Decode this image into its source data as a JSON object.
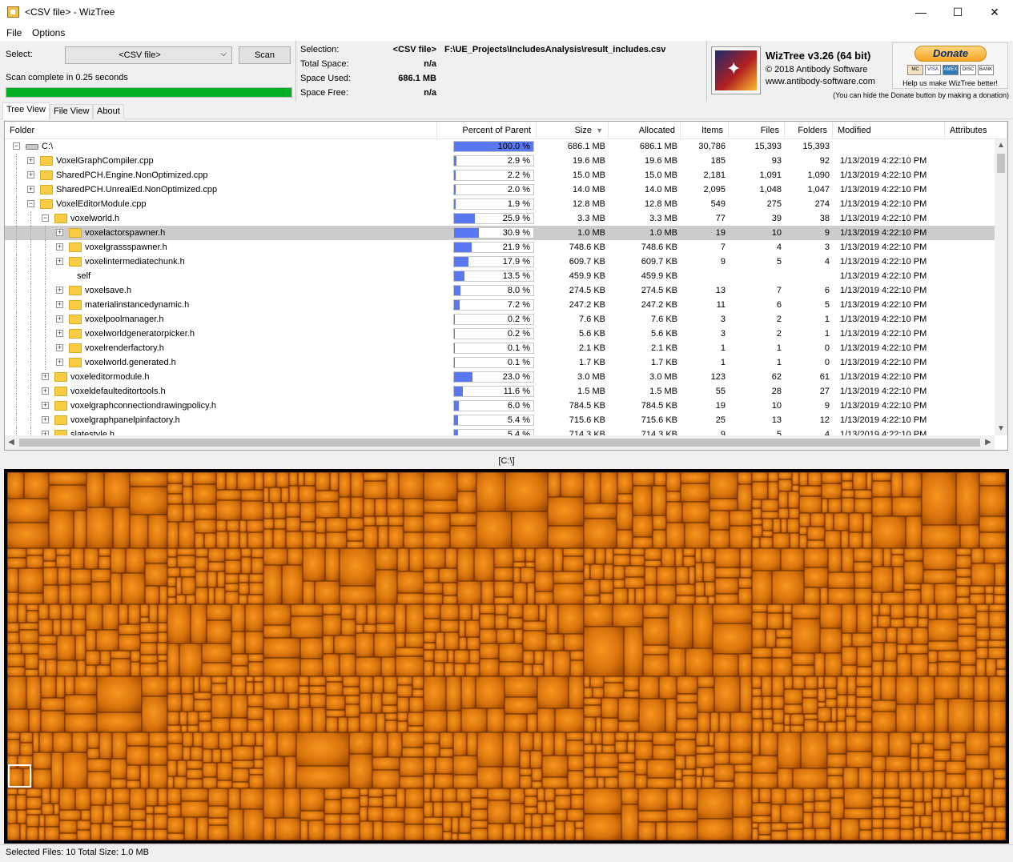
{
  "window": {
    "title": "<CSV file> - WizTree",
    "minimize": "—",
    "maximize": "☐",
    "close": "✕"
  },
  "menu": {
    "file": "File",
    "options": "Options"
  },
  "toolbar": {
    "select_label": "Select:",
    "source_value": "<CSV file>",
    "scan_label": "Scan",
    "scan_status": "Scan complete in 0.25 seconds",
    "progress_fraction": 1.0
  },
  "info": {
    "selection_label": "Selection:",
    "selection_value": "<CSV file>",
    "selection_path": "F:\\UE_Projects\\IncludesAnalysis\\result_includes.csv",
    "total_label": "Total Space:",
    "total_value": "n/a",
    "used_label": "Space Used:",
    "used_value": "686.1 MB",
    "free_label": "Space Free:",
    "free_value": "n/a"
  },
  "about": {
    "product": "WizTree v3.26 (64 bit)",
    "copyright": "© 2018 Antibody Software",
    "website": "www.antibody-software.com"
  },
  "donate": {
    "button": "Donate",
    "cards": [
      "MC",
      "VISA",
      "AMEX",
      "DISC",
      "BANK"
    ],
    "help": "Help us make WizTree better!",
    "note": "(You can hide the Donate button by making a donation)"
  },
  "tabs": [
    {
      "label": "Tree View"
    },
    {
      "label": "File View"
    },
    {
      "label": "About"
    }
  ],
  "columns": {
    "folder": "Folder",
    "percent": "Percent of Parent",
    "size": "Size",
    "allocated": "Allocated",
    "items": "Items",
    "files": "Files",
    "folders": "Folders",
    "modified": "Modified",
    "attributes": "Attributes"
  },
  "rows": [
    {
      "name": "C:\\",
      "level": 0,
      "type": "drive",
      "expander": "−",
      "pct_label": "100.0 %",
      "pct": 100.0,
      "size": "686.1 MB",
      "allocated": "686.1 MB",
      "items": "30,786",
      "files": "15,393",
      "folders": "15,393",
      "modified": ""
    },
    {
      "name": "VoxelGraphCompiler.cpp",
      "level": 1,
      "type": "folder",
      "expander": "+",
      "pct_label": "2.9 %",
      "pct": 2.9,
      "size": "19.6 MB",
      "allocated": "19.6 MB",
      "items": "185",
      "files": "93",
      "folders": "92",
      "modified": "1/13/2019 4:22:10 PM"
    },
    {
      "name": "SharedPCH.Engine.NonOptimized.cpp",
      "level": 1,
      "type": "folder",
      "expander": "+",
      "pct_label": "2.2 %",
      "pct": 2.2,
      "size": "15.0 MB",
      "allocated": "15.0 MB",
      "items": "2,181",
      "files": "1,091",
      "folders": "1,090",
      "modified": "1/13/2019 4:22:10 PM"
    },
    {
      "name": "SharedPCH.UnrealEd.NonOptimized.cpp",
      "level": 1,
      "type": "folder",
      "expander": "+",
      "pct_label": "2.0 %",
      "pct": 2.0,
      "size": "14.0 MB",
      "allocated": "14.0 MB",
      "items": "2,095",
      "files": "1,048",
      "folders": "1,047",
      "modified": "1/13/2019 4:22:10 PM"
    },
    {
      "name": "VoxelEditorModule.cpp",
      "level": 1,
      "type": "folder",
      "expander": "−",
      "pct_label": "1.9 %",
      "pct": 1.9,
      "size": "12.8 MB",
      "allocated": "12.8 MB",
      "items": "549",
      "files": "275",
      "folders": "274",
      "modified": "1/13/2019 4:22:10 PM"
    },
    {
      "name": "voxelworld.h",
      "level": 2,
      "type": "folder",
      "expander": "−",
      "pct_label": "25.9 %",
      "pct": 25.9,
      "size": "3.3 MB",
      "allocated": "3.3 MB",
      "items": "77",
      "files": "39",
      "folders": "38",
      "modified": "1/13/2019 4:22:10 PM"
    },
    {
      "name": "voxelactorspawner.h",
      "level": 3,
      "type": "folder",
      "expander": "+",
      "pct_label": "30.9 %",
      "pct": 30.9,
      "size": "1.0 MB",
      "allocated": "1.0 MB",
      "items": "19",
      "files": "10",
      "folders": "9",
      "modified": "1/13/2019 4:22:10 PM",
      "selected": true
    },
    {
      "name": "voxelgrassspawner.h",
      "level": 3,
      "type": "folder",
      "expander": "+",
      "pct_label": "21.9 %",
      "pct": 21.9,
      "size": "748.6 KB",
      "allocated": "748.6 KB",
      "items": "7",
      "files": "4",
      "folders": "3",
      "modified": "1/13/2019 4:22:10 PM"
    },
    {
      "name": "voxelintermediatechunk.h",
      "level": 3,
      "type": "folder",
      "expander": "+",
      "pct_label": "17.9 %",
      "pct": 17.9,
      "size": "609.7 KB",
      "allocated": "609.7 KB",
      "items": "9",
      "files": "5",
      "folders": "4",
      "modified": "1/13/2019 4:22:10 PM"
    },
    {
      "name": "self",
      "level": 3,
      "type": "self",
      "expander": "",
      "pct_label": "13.5 %",
      "pct": 13.5,
      "size": "459.9 KB",
      "allocated": "459.9 KB",
      "items": "",
      "files": "",
      "folders": "",
      "modified": "1/13/2019 4:22:10 PM"
    },
    {
      "name": "voxelsave.h",
      "level": 3,
      "type": "folder",
      "expander": "+",
      "pct_label": "8.0 %",
      "pct": 8.0,
      "size": "274.5 KB",
      "allocated": "274.5 KB",
      "items": "13",
      "files": "7",
      "folders": "6",
      "modified": "1/13/2019 4:22:10 PM"
    },
    {
      "name": "materialinstancedynamic.h",
      "level": 3,
      "type": "folder",
      "expander": "+",
      "pct_label": "7.2 %",
      "pct": 7.2,
      "size": "247.2 KB",
      "allocated": "247.2 KB",
      "items": "11",
      "files": "6",
      "folders": "5",
      "modified": "1/13/2019 4:22:10 PM"
    },
    {
      "name": "voxelpoolmanager.h",
      "level": 3,
      "type": "folder",
      "expander": "+",
      "pct_label": "0.2 %",
      "pct": 0.2,
      "size": "7.6 KB",
      "allocated": "7.6 KB",
      "items": "3",
      "files": "2",
      "folders": "1",
      "modified": "1/13/2019 4:22:10 PM"
    },
    {
      "name": "voxelworldgeneratorpicker.h",
      "level": 3,
      "type": "folder",
      "expander": "+",
      "pct_label": "0.2 %",
      "pct": 0.2,
      "size": "5.6 KB",
      "allocated": "5.6 KB",
      "items": "3",
      "files": "2",
      "folders": "1",
      "modified": "1/13/2019 4:22:10 PM"
    },
    {
      "name": "voxelrenderfactory.h",
      "level": 3,
      "type": "folder",
      "expander": "+",
      "pct_label": "0.1 %",
      "pct": 0.1,
      "size": "2.1 KB",
      "allocated": "2.1 KB",
      "items": "1",
      "files": "1",
      "folders": "0",
      "modified": "1/13/2019 4:22:10 PM"
    },
    {
      "name": "voxelworld.generated.h",
      "level": 3,
      "type": "folder",
      "expander": "+",
      "pct_label": "0.1 %",
      "pct": 0.1,
      "size": "1.7 KB",
      "allocated": "1.7 KB",
      "items": "1",
      "files": "1",
      "folders": "0",
      "modified": "1/13/2019 4:22:10 PM"
    },
    {
      "name": "voxeleditormodule.h",
      "level": 2,
      "type": "folder",
      "expander": "+",
      "pct_label": "23.0 %",
      "pct": 23.0,
      "size": "3.0 MB",
      "allocated": "3.0 MB",
      "items": "123",
      "files": "62",
      "folders": "61",
      "modified": "1/13/2019 4:22:10 PM"
    },
    {
      "name": "voxeldefaulteditortools.h",
      "level": 2,
      "type": "folder",
      "expander": "+",
      "pct_label": "11.6 %",
      "pct": 11.6,
      "size": "1.5 MB",
      "allocated": "1.5 MB",
      "items": "55",
      "files": "28",
      "folders": "27",
      "modified": "1/13/2019 4:22:10 PM"
    },
    {
      "name": "voxelgraphconnectiondrawingpolicy.h",
      "level": 2,
      "type": "folder",
      "expander": "+",
      "pct_label": "6.0 %",
      "pct": 6.0,
      "size": "784.5 KB",
      "allocated": "784.5 KB",
      "items": "19",
      "files": "10",
      "folders": "9",
      "modified": "1/13/2019 4:22:10 PM"
    },
    {
      "name": "voxelgraphpanelpinfactory.h",
      "level": 2,
      "type": "folder",
      "expander": "+",
      "pct_label": "5.4 %",
      "pct": 5.4,
      "size": "715.6 KB",
      "allocated": "715.6 KB",
      "items": "25",
      "files": "13",
      "folders": "12",
      "modified": "1/13/2019 4:22:10 PM"
    },
    {
      "name": "slatestyle.h",
      "level": 2,
      "type": "folder",
      "expander": "+",
      "pct_label": "5.4 %",
      "pct": 5.4,
      "size": "714.3 KB",
      "allocated": "714.3 KB",
      "items": "9",
      "files": "5",
      "folders": "4",
      "modified": "1/13/2019 4:22:10 PM"
    }
  ],
  "treemap": {
    "caption": "[C:\\]"
  },
  "status": {
    "text": "Selected Files: 10  Total Size: 1.0 MB"
  }
}
